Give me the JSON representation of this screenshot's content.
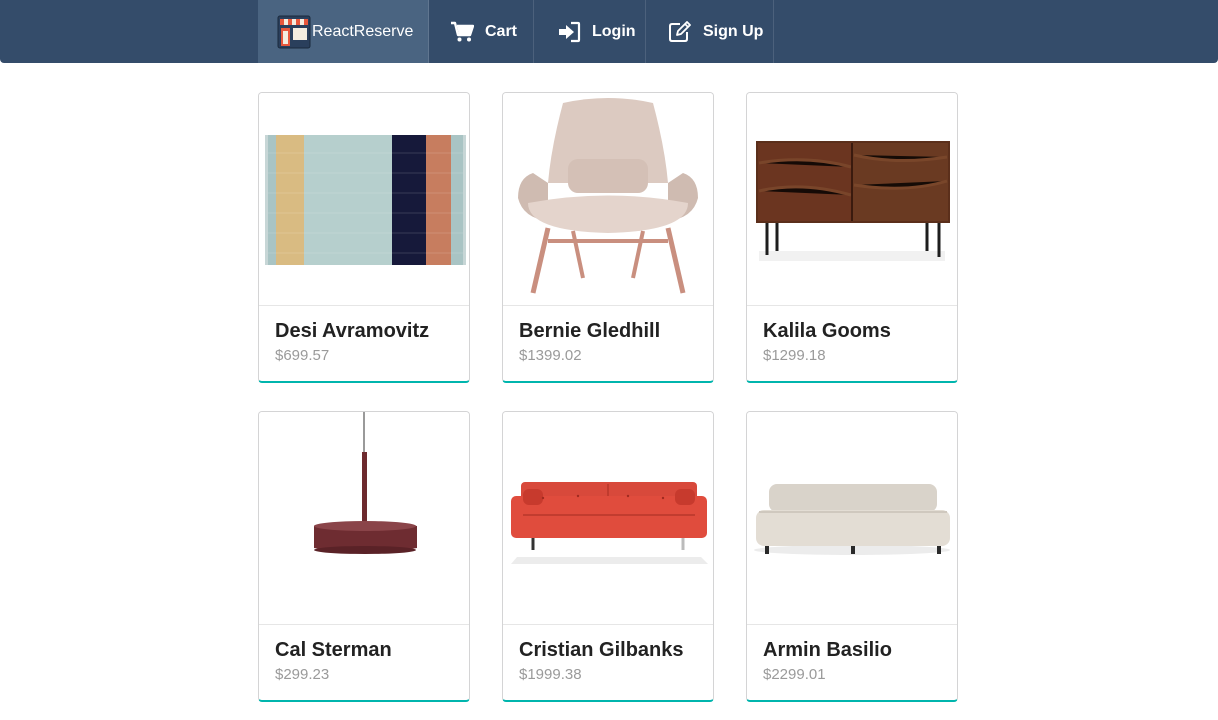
{
  "nav": {
    "brand": "ReactReserve",
    "cart": "Cart",
    "login": "Login",
    "signup": "Sign Up"
  },
  "products": [
    {
      "name": "Desi Avramovitz",
      "price": "$699.57"
    },
    {
      "name": "Bernie Gledhill",
      "price": "$1399.02"
    },
    {
      "name": "Kalila Gooms",
      "price": "$1299.18"
    },
    {
      "name": "Cal Sterman",
      "price": "$299.23"
    },
    {
      "name": "Cristian Gilbanks",
      "price": "$1999.38"
    },
    {
      "name": "Armin Basilio",
      "price": "$2299.01"
    }
  ],
  "colors": {
    "navbar": "#344c6a",
    "brand_bg": "#4a6481",
    "card_accent": "#00b5ad"
  }
}
